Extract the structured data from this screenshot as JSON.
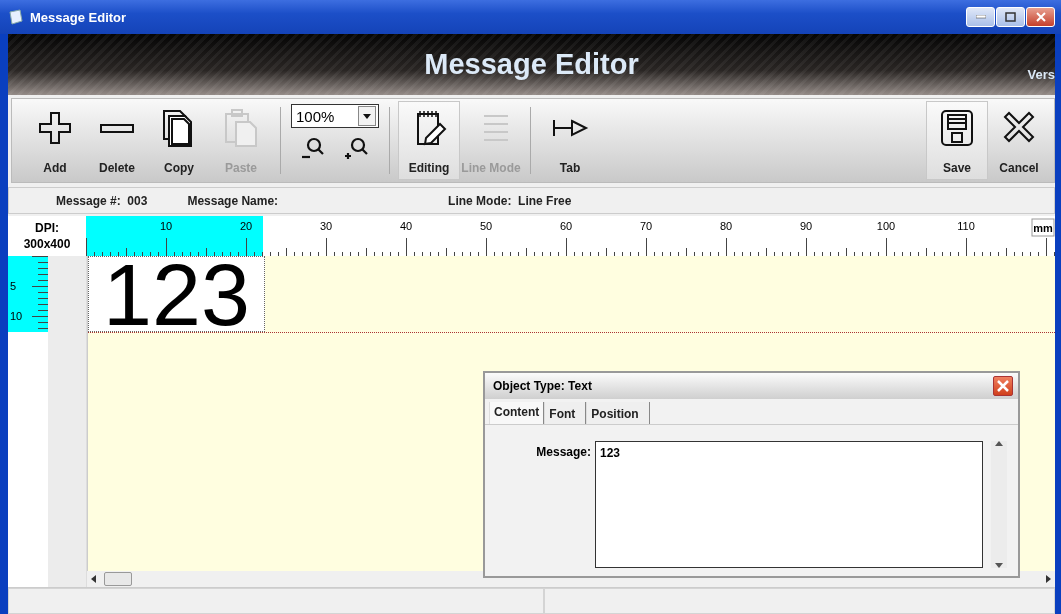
{
  "window": {
    "title": "Message Editor"
  },
  "header": {
    "title": "Message Editor",
    "version_fragment": "Vers"
  },
  "toolbar": {
    "items": [
      {
        "kind": "button",
        "label": "Add",
        "disabled": false,
        "selected": false
      },
      {
        "kind": "button",
        "label": "Delete",
        "disabled": false,
        "selected": false
      },
      {
        "kind": "button",
        "label": "Copy",
        "disabled": false,
        "selected": false
      },
      {
        "kind": "button",
        "label": "Paste",
        "disabled": true,
        "selected": false
      },
      {
        "kind": "zoom",
        "value": "100%"
      },
      {
        "kind": "button",
        "label": "Editing",
        "disabled": false,
        "selected": true
      },
      {
        "kind": "button",
        "label": "Line Mode",
        "disabled": true,
        "selected": false
      },
      {
        "kind": "button",
        "label": "Tab",
        "disabled": false,
        "selected": false
      },
      {
        "kind": "spacer"
      },
      {
        "kind": "button",
        "label": "Save",
        "disabled": false,
        "selected": true
      },
      {
        "kind": "button",
        "label": "Cancel",
        "disabled": false,
        "selected": false
      }
    ]
  },
  "info": {
    "message_number_label": "Message #:",
    "message_number": "003",
    "message_name_label": "Message Name:",
    "line_mode_label": "Line Mode:",
    "line_mode": "Line Free"
  },
  "ruler": {
    "dpi_label": "DPI:",
    "dpi": "300x400",
    "unit": "mm",
    "marks": [
      "10",
      "20",
      "30",
      "40",
      "50",
      "60",
      "70",
      "80",
      "90",
      "100",
      "110"
    ],
    "vertical_marks": [
      "5",
      "10"
    ]
  },
  "canvas": {
    "object_text": "123"
  },
  "dialog": {
    "title": "Object Type: Text",
    "tabs": [
      {
        "label": "Content",
        "selected": true
      },
      {
        "label": "Font",
        "selected": false
      },
      {
        "label": "Position",
        "selected": false
      }
    ],
    "field_label": "Message:",
    "field_value": "123"
  }
}
